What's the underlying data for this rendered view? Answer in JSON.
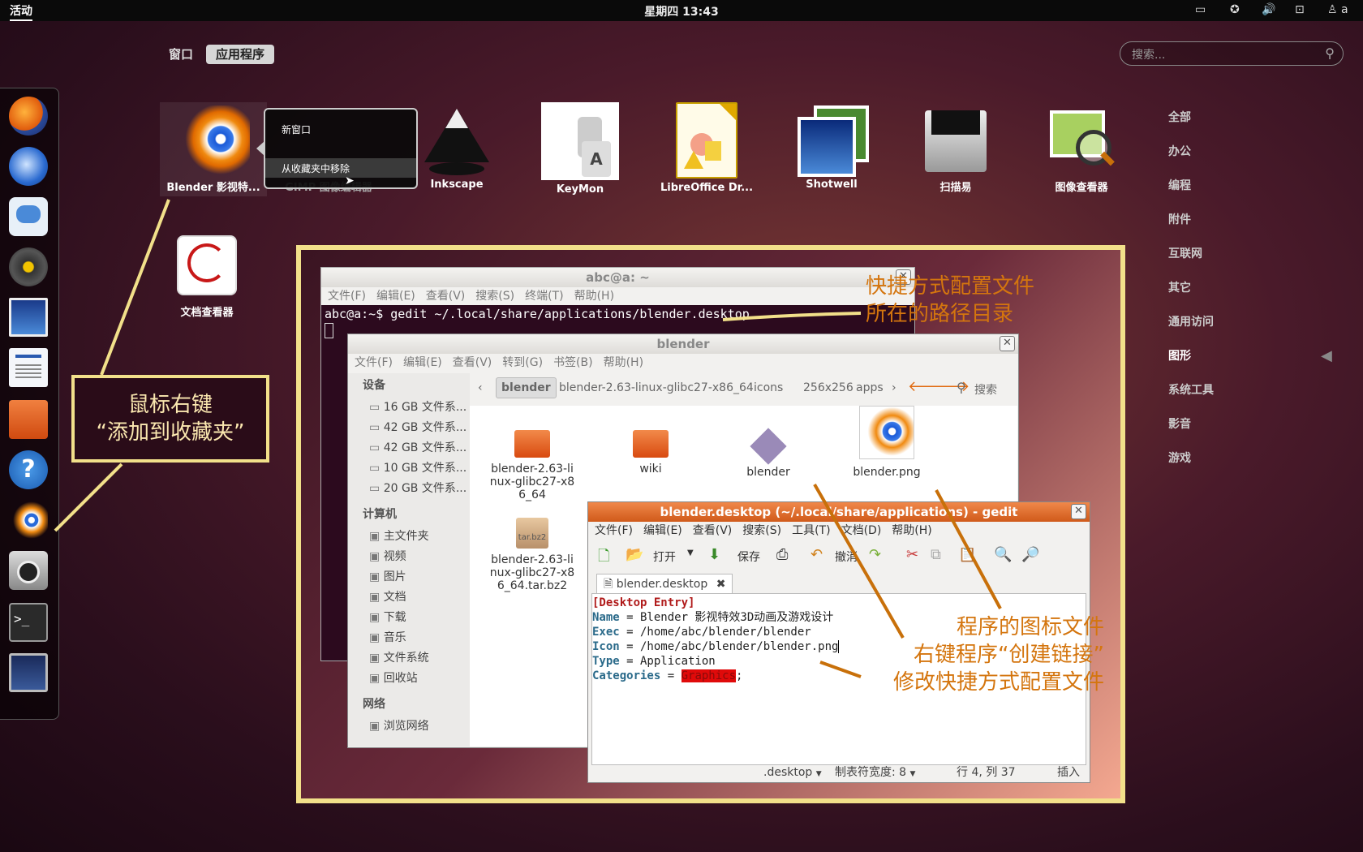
{
  "top_panel": {
    "activities": "活动",
    "clock": "星期四 13:43",
    "user": "a"
  },
  "view_switcher": {
    "windows": "窗口",
    "applications": "应用程序"
  },
  "search": {
    "placeholder": "搜索..."
  },
  "categories": [
    "全部",
    "办公",
    "编程",
    "附件",
    "互联网",
    "其它",
    "通用访问",
    "图形",
    "系统工具",
    "影音",
    "游戏"
  ],
  "dock_icons": [
    "firefox-icon",
    "thunderbird-icon",
    "empathy-icon",
    "rhythmbox-icon",
    "shotwell-icon",
    "writer-icon",
    "home-folder-icon",
    "help-icon",
    "blender-icon",
    "camera-icon",
    "terminal-icon",
    "screensaver-icon"
  ],
  "apps": [
    {
      "label": "Blender 影视特...",
      "icon": "blender-icon"
    },
    {
      "label": "GIMP 图像编辑器",
      "icon": "gimp-icon"
    },
    {
      "label": "Inkscape",
      "icon": "inkscape-icon"
    },
    {
      "label": "KeyMon",
      "icon": "keymon-icon"
    },
    {
      "label": "LibreOffice Dr...",
      "icon": "libreoffice-draw-icon"
    },
    {
      "label": "Shotwell",
      "icon": "shotwell-icon"
    },
    {
      "label": "扫描易",
      "icon": "scanner-icon"
    },
    {
      "label": "图像查看器",
      "icon": "image-viewer-icon"
    },
    {
      "label": "文档查看器",
      "icon": "document-viewer-icon"
    }
  ],
  "context_menu": {
    "new_window": "新窗口",
    "remove_favorite": "从收藏夹中移除"
  },
  "annotations": {
    "left_line1": "鼠标右键",
    "left_line2": "“添加到收藏夹”",
    "path_line1": "快捷方式配置文件",
    "path_line2": "所在的路径目录",
    "icon_file": "程序的图标文件",
    "create_link": "右键程序“创建链接”",
    "modify_config": "修改快捷方式配置文件"
  },
  "terminal": {
    "title": "abc@a: ~",
    "menu": [
      "文件(F)",
      "编辑(E)",
      "查看(V)",
      "搜索(S)",
      "终端(T)",
      "帮助(H)"
    ],
    "command": "abc@a:~$ gedit ~/.local/share/applications/blender.desktop"
  },
  "file_manager": {
    "title": "blender",
    "menu": [
      "文件(F)",
      "编辑(E)",
      "查看(V)",
      "转到(G)",
      "书签(B)",
      "帮助(H)"
    ],
    "breadcrumbs": [
      "blender",
      "blender-2.63-linux-glibc27-x86_64",
      "icons",
      "256x256",
      "apps"
    ],
    "search_label": "搜索",
    "sidebar": {
      "devices_header": "设备",
      "devices": [
        "16 GB 文件系...",
        "42 GB 文件系...",
        "42 GB 文件系...",
        "10 GB 文件系...",
        "20 GB 文件系..."
      ],
      "computer_header": "计算机",
      "computer": [
        "主文件夹",
        "视频",
        "图片",
        "文档",
        "下载",
        "音乐",
        "文件系统",
        "回收站"
      ],
      "network_header": "网络",
      "network": [
        "浏览网络"
      ]
    },
    "files": [
      {
        "name": "blender-2.63-linux-glibc27-x86_64",
        "icon": "folder-icon"
      },
      {
        "name": "wiki",
        "icon": "folder-icon"
      },
      {
        "name": "blender",
        "icon": "executable-link-icon"
      },
      {
        "name": "blender.png",
        "icon": "blender-icon"
      },
      {
        "name": "blender-2.63-linux-glibc27-x86_64.tar.bz2",
        "icon": "archive-icon"
      }
    ]
  },
  "gedit": {
    "title": "blender.desktop (~/.local/share/applications) - gedit",
    "menu": [
      "文件(F)",
      "编辑(E)",
      "查看(V)",
      "搜索(S)",
      "工具(T)",
      "文档(D)",
      "帮助(H)"
    ],
    "toolbar": {
      "open": "打开",
      "save": "保存",
      "undo": "撤消"
    },
    "tab": "blender.desktop",
    "lines": {
      "section": "[Desktop Entry]",
      "name_key": "Name",
      "name_val": " = Blender 影视特效3D动画及游戏设计",
      "exec_key": "Exec",
      "exec_val": " = /home/abc/blender/blender",
      "icon_key": "Icon",
      "icon_val": " = /home/abc/blender/blender.png",
      "type_key": "Type",
      "type_val": " = Application",
      "cat_key": "Categories",
      "cat_eq": " = ",
      "cat_val": "Graphics",
      "cat_end": ";"
    },
    "status": {
      "filetype": ".desktop",
      "tabwidth": "制表符宽度: 8",
      "position": "行 4, 列 37",
      "mode": "插入"
    }
  }
}
